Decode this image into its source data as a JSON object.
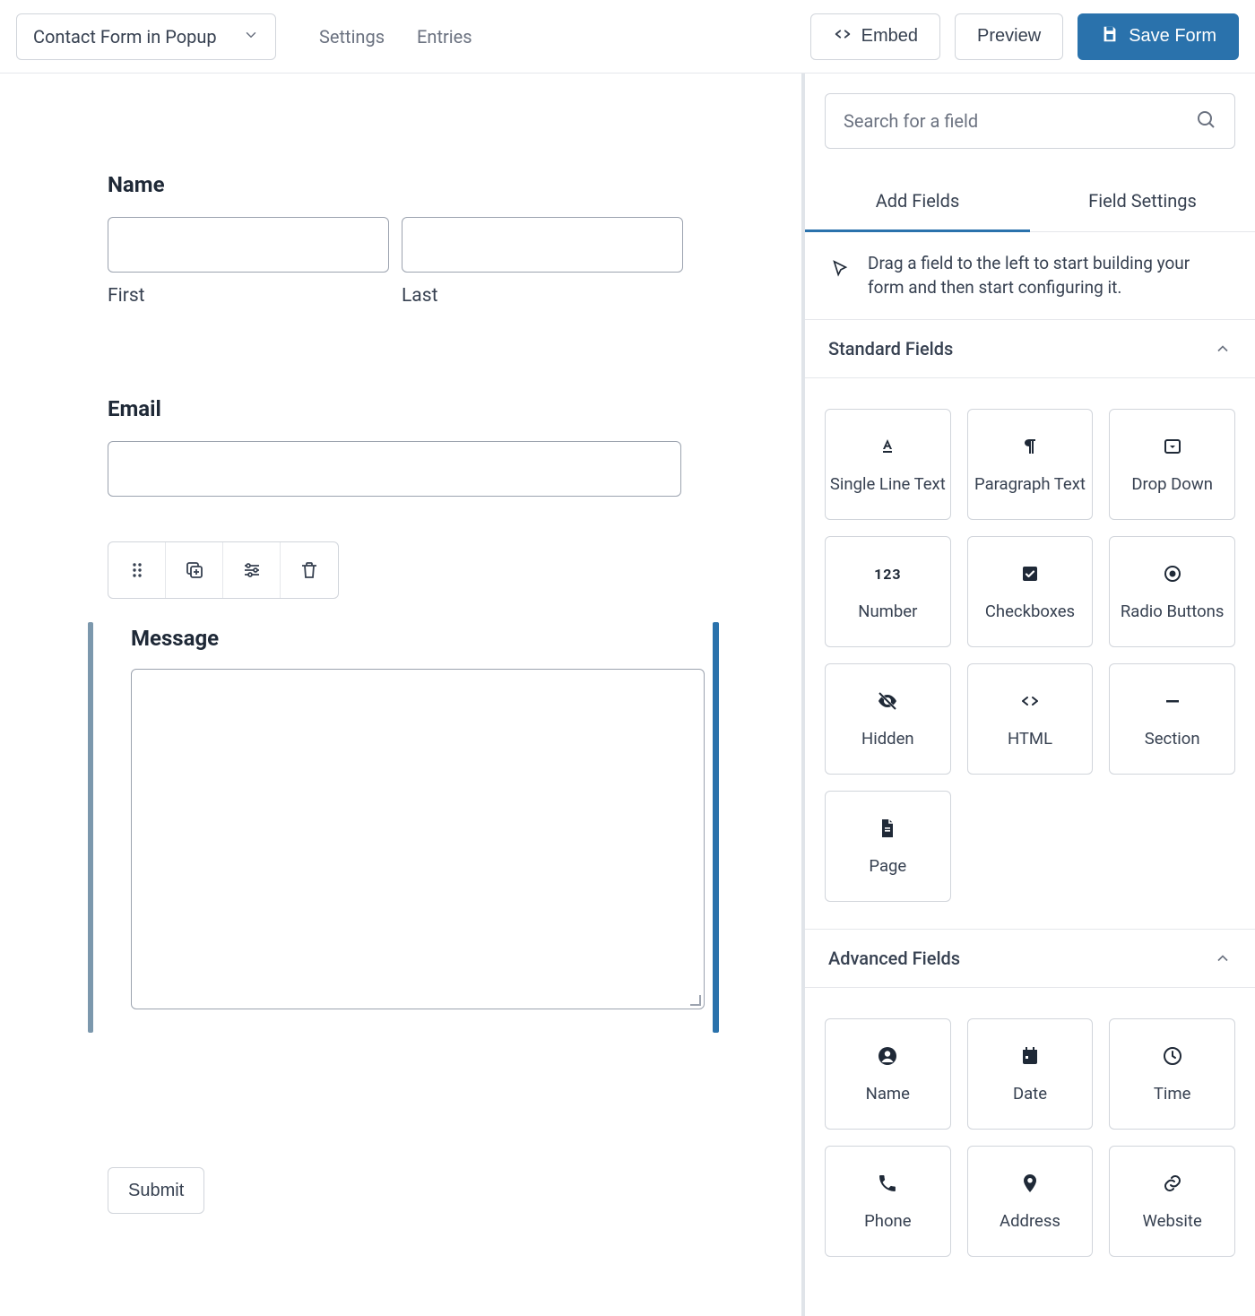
{
  "header": {
    "form_title": "Contact Form in Popup",
    "nav": {
      "settings": "Settings",
      "entries": "Entries"
    },
    "embed": "Embed",
    "preview": "Preview",
    "save": "Save Form"
  },
  "form": {
    "name": {
      "label": "Name",
      "first": "First",
      "last": "Last"
    },
    "email": {
      "label": "Email"
    },
    "message": {
      "label": "Message"
    },
    "submit": "Submit"
  },
  "sidebar": {
    "search_placeholder": "Search for a field",
    "tabs": {
      "add": "Add Fields",
      "settings": "Field Settings"
    },
    "hint": "Drag a field to the left to start building your form and then start configuring it.",
    "groups": {
      "standard": {
        "title": "Standard Fields",
        "items": [
          {
            "key": "single_line_text",
            "label": "Single Line Text",
            "icon": "text-format"
          },
          {
            "key": "paragraph_text",
            "label": "Paragraph Text",
            "icon": "pilcrow"
          },
          {
            "key": "drop_down",
            "label": "Drop Down",
            "icon": "dropdown"
          },
          {
            "key": "number",
            "label": "Number",
            "icon": "num123"
          },
          {
            "key": "checkboxes",
            "label": "Checkboxes",
            "icon": "checkbox"
          },
          {
            "key": "radio_buttons",
            "label": "Radio Buttons",
            "icon": "radio"
          },
          {
            "key": "hidden",
            "label": "Hidden",
            "icon": "eye-off"
          },
          {
            "key": "html",
            "label": "HTML",
            "icon": "code"
          },
          {
            "key": "section",
            "label": "Section",
            "icon": "minus"
          },
          {
            "key": "page",
            "label": "Page",
            "icon": "page"
          }
        ]
      },
      "advanced": {
        "title": "Advanced Fields",
        "items": [
          {
            "key": "name",
            "label": "Name",
            "icon": "person"
          },
          {
            "key": "date",
            "label": "Date",
            "icon": "calendar"
          },
          {
            "key": "time",
            "label": "Time",
            "icon": "clock"
          },
          {
            "key": "phone",
            "label": "Phone",
            "icon": "phone"
          },
          {
            "key": "address",
            "label": "Address",
            "icon": "pin"
          },
          {
            "key": "website",
            "label": "Website",
            "icon": "link"
          }
        ]
      }
    }
  }
}
